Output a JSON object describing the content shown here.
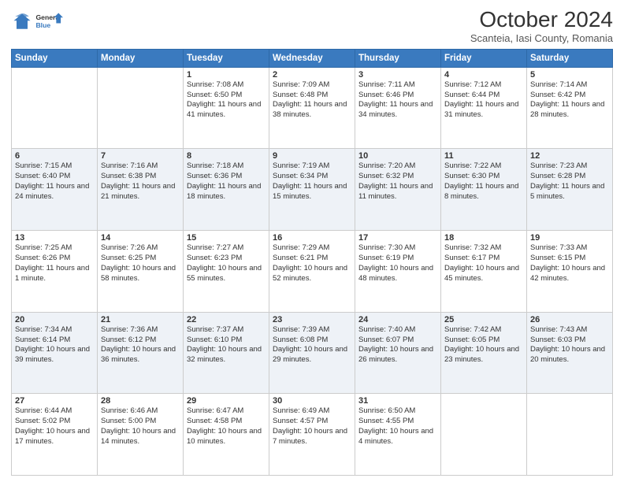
{
  "header": {
    "logo": {
      "line1": "General",
      "line2": "Blue"
    },
    "title": "October 2024",
    "subtitle": "Scanteia, Iasi County, Romania"
  },
  "days_of_week": [
    "Sunday",
    "Monday",
    "Tuesday",
    "Wednesday",
    "Thursday",
    "Friday",
    "Saturday"
  ],
  "weeks": [
    [
      {
        "day": "",
        "empty": true
      },
      {
        "day": "",
        "empty": true
      },
      {
        "day": "1",
        "sunrise": "7:08 AM",
        "sunset": "6:50 PM",
        "daylight": "11 hours and 41 minutes."
      },
      {
        "day": "2",
        "sunrise": "7:09 AM",
        "sunset": "6:48 PM",
        "daylight": "11 hours and 38 minutes."
      },
      {
        "day": "3",
        "sunrise": "7:11 AM",
        "sunset": "6:46 PM",
        "daylight": "11 hours and 34 minutes."
      },
      {
        "day": "4",
        "sunrise": "7:12 AM",
        "sunset": "6:44 PM",
        "daylight": "11 hours and 31 minutes."
      },
      {
        "day": "5",
        "sunrise": "7:14 AM",
        "sunset": "6:42 PM",
        "daylight": "11 hours and 28 minutes."
      }
    ],
    [
      {
        "day": "6",
        "sunrise": "7:15 AM",
        "sunset": "6:40 PM",
        "daylight": "11 hours and 24 minutes."
      },
      {
        "day": "7",
        "sunrise": "7:16 AM",
        "sunset": "6:38 PM",
        "daylight": "11 hours and 21 minutes."
      },
      {
        "day": "8",
        "sunrise": "7:18 AM",
        "sunset": "6:36 PM",
        "daylight": "11 hours and 18 minutes."
      },
      {
        "day": "9",
        "sunrise": "7:19 AM",
        "sunset": "6:34 PM",
        "daylight": "11 hours and 15 minutes."
      },
      {
        "day": "10",
        "sunrise": "7:20 AM",
        "sunset": "6:32 PM",
        "daylight": "11 hours and 11 minutes."
      },
      {
        "day": "11",
        "sunrise": "7:22 AM",
        "sunset": "6:30 PM",
        "daylight": "11 hours and 8 minutes."
      },
      {
        "day": "12",
        "sunrise": "7:23 AM",
        "sunset": "6:28 PM",
        "daylight": "11 hours and 5 minutes."
      }
    ],
    [
      {
        "day": "13",
        "sunrise": "7:25 AM",
        "sunset": "6:26 PM",
        "daylight": "11 hours and 1 minute."
      },
      {
        "day": "14",
        "sunrise": "7:26 AM",
        "sunset": "6:25 PM",
        "daylight": "10 hours and 58 minutes."
      },
      {
        "day": "15",
        "sunrise": "7:27 AM",
        "sunset": "6:23 PM",
        "daylight": "10 hours and 55 minutes."
      },
      {
        "day": "16",
        "sunrise": "7:29 AM",
        "sunset": "6:21 PM",
        "daylight": "10 hours and 52 minutes."
      },
      {
        "day": "17",
        "sunrise": "7:30 AM",
        "sunset": "6:19 PM",
        "daylight": "10 hours and 48 minutes."
      },
      {
        "day": "18",
        "sunrise": "7:32 AM",
        "sunset": "6:17 PM",
        "daylight": "10 hours and 45 minutes."
      },
      {
        "day": "19",
        "sunrise": "7:33 AM",
        "sunset": "6:15 PM",
        "daylight": "10 hours and 42 minutes."
      }
    ],
    [
      {
        "day": "20",
        "sunrise": "7:34 AM",
        "sunset": "6:14 PM",
        "daylight": "10 hours and 39 minutes."
      },
      {
        "day": "21",
        "sunrise": "7:36 AM",
        "sunset": "6:12 PM",
        "daylight": "10 hours and 36 minutes."
      },
      {
        "day": "22",
        "sunrise": "7:37 AM",
        "sunset": "6:10 PM",
        "daylight": "10 hours and 32 minutes."
      },
      {
        "day": "23",
        "sunrise": "7:39 AM",
        "sunset": "6:08 PM",
        "daylight": "10 hours and 29 minutes."
      },
      {
        "day": "24",
        "sunrise": "7:40 AM",
        "sunset": "6:07 PM",
        "daylight": "10 hours and 26 minutes."
      },
      {
        "day": "25",
        "sunrise": "7:42 AM",
        "sunset": "6:05 PM",
        "daylight": "10 hours and 23 minutes."
      },
      {
        "day": "26",
        "sunrise": "7:43 AM",
        "sunset": "6:03 PM",
        "daylight": "10 hours and 20 minutes."
      }
    ],
    [
      {
        "day": "27",
        "sunrise": "6:44 AM",
        "sunset": "5:02 PM",
        "daylight": "10 hours and 17 minutes."
      },
      {
        "day": "28",
        "sunrise": "6:46 AM",
        "sunset": "5:00 PM",
        "daylight": "10 hours and 14 minutes."
      },
      {
        "day": "29",
        "sunrise": "6:47 AM",
        "sunset": "4:58 PM",
        "daylight": "10 hours and 10 minutes."
      },
      {
        "day": "30",
        "sunrise": "6:49 AM",
        "sunset": "4:57 PM",
        "daylight": "10 hours and 7 minutes."
      },
      {
        "day": "31",
        "sunrise": "6:50 AM",
        "sunset": "4:55 PM",
        "daylight": "10 hours and 4 minutes."
      },
      {
        "day": "",
        "empty": true
      },
      {
        "day": "",
        "empty": true
      }
    ]
  ]
}
